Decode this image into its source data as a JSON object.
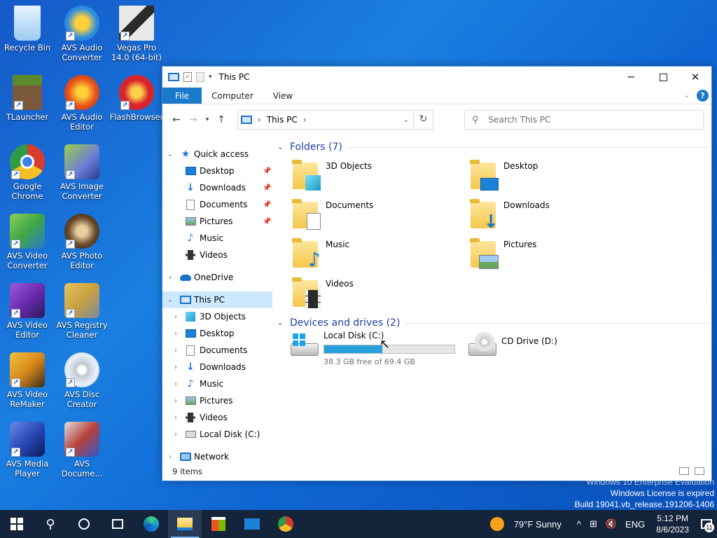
{
  "desktop": {
    "icons": [
      {
        "label": "Recycle Bin",
        "color": "#bfe3ff"
      },
      {
        "label": "AVS Audio Converter",
        "color": "#2a8be0"
      },
      {
        "label": "Vegas Pro 14.0 (64-bit)",
        "color": "#3a3a3a"
      },
      {
        "label": "TLauncher",
        "color": "#5c8a2a"
      },
      {
        "label": "AVS Audio Editor",
        "color": "#e8541c"
      },
      {
        "label": "FlashBrowser",
        "color": "#d8242c"
      },
      {
        "label": "Google Chrome",
        "color": "#2f9a48"
      },
      {
        "label": "AVS Image Converter",
        "color": "#6a7bd8"
      },
      {
        "label": "AVS Video Converter",
        "color": "#3fa548"
      },
      {
        "label": "AVS Photo Editor",
        "color": "#6b4a2a"
      },
      {
        "label": "AVS Video Editor",
        "color": "#6a2bb0"
      },
      {
        "label": "AVS Registry Cleaner",
        "color": "#c8a040"
      },
      {
        "label": "AVS Video ReMaker",
        "color": "#d88a1a"
      },
      {
        "label": "AVS Disc Creator",
        "color": "#c0c8d0"
      },
      {
        "label": "AVS Media Player",
        "color": "#2a4ab8"
      },
      {
        "label": "AVS Docume...",
        "color": "#b8403a"
      }
    ]
  },
  "window": {
    "title": "This PC",
    "ribbon_tabs": [
      "File",
      "Computer",
      "View"
    ],
    "help": "?",
    "address": "This PC",
    "search_placeholder": "Search This PC",
    "status": "9 items"
  },
  "nav": {
    "quick_access": "Quick access",
    "quick_items": [
      "Desktop",
      "Downloads",
      "Documents",
      "Pictures",
      "Music",
      "Videos"
    ],
    "onedrive": "OneDrive",
    "this_pc": "This PC",
    "pc_items": [
      "3D Objects",
      "Desktop",
      "Documents",
      "Downloads",
      "Music",
      "Pictures",
      "Videos",
      "Local Disk (C:)"
    ],
    "network": "Network"
  },
  "content": {
    "folders_header": "Folders (7)",
    "folders": [
      "3D Objects",
      "Desktop",
      "Documents",
      "Downloads",
      "Music",
      "Pictures",
      "Videos"
    ],
    "drives_header": "Devices and drives (2)",
    "drive_c": {
      "name": "Local Disk (C:)",
      "free": "38.3 GB free of 69.4 GB",
      "used_fraction": 0.448,
      "bar_color": "#26a0da"
    },
    "drive_d": {
      "name": "CD Drive (D:)"
    }
  },
  "watermark": {
    "line1": "Windows 10 Enterprise Evaluation",
    "line2": "Windows License is expired",
    "line3": "Build 19041.vb_release.191206-1406"
  },
  "taskbar": {
    "weather": "79°F  Sunny",
    "lang": "ENG",
    "time": "5:12 PM",
    "date": "8/6/2023",
    "notifications": "11"
  }
}
